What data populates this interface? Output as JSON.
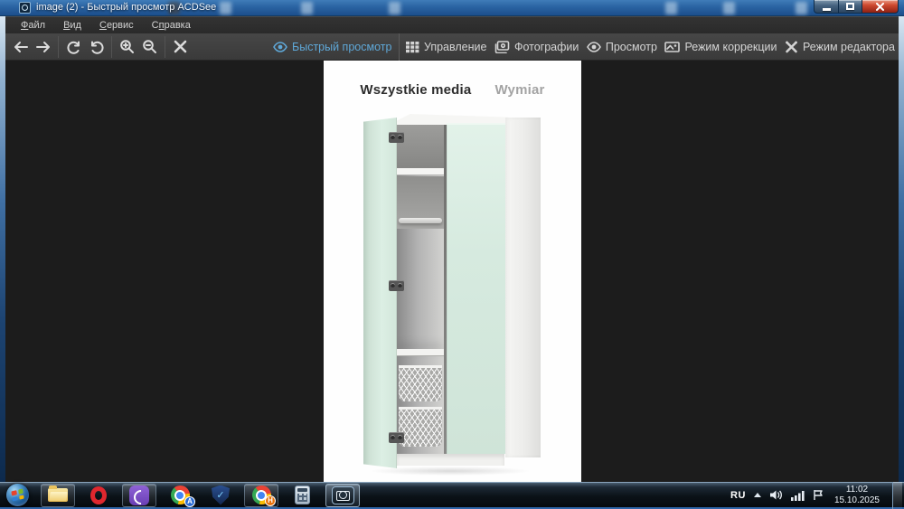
{
  "window": {
    "title": "image (2) - Быстрый просмотр ACDSee"
  },
  "menu": {
    "items": [
      {
        "pre": "",
        "hot": "Ф",
        "post": "айл"
      },
      {
        "pre": "",
        "hot": "В",
        "post": "ид"
      },
      {
        "pre": "",
        "hot": "С",
        "post": "ервис"
      },
      {
        "pre": "С",
        "hot": "п",
        "post": "равка"
      }
    ]
  },
  "toolbar": {
    "buttons": [
      "back",
      "forward",
      "rotate-left",
      "rotate-right",
      "zoom-in",
      "zoom-out",
      "close-image"
    ]
  },
  "modes": {
    "tabs": [
      {
        "label": "Быстрый просмотр",
        "icon": "quick-view-eye-icon",
        "active": true
      },
      {
        "label": "Управление",
        "icon": "manage-grid-icon",
        "active": false
      },
      {
        "label": "Фотографии",
        "icon": "photos-icon",
        "active": false
      },
      {
        "label": "Просмотр",
        "icon": "view-eye-icon",
        "active": false
      },
      {
        "label": "Режим коррекции",
        "icon": "develop-mode-icon",
        "active": false
      },
      {
        "label": "Режим редактора",
        "icon": "edit-mode-icon",
        "active": false
      }
    ]
  },
  "viewer": {
    "tab_all_media": "Wszystkie media",
    "tab_dimension": "Wymiar",
    "image_subject": "tall white wardrobe with pale mint doors, open door revealing shelf, clothes rail and two wire baskets"
  },
  "taskbar": {
    "apps": [
      {
        "name": "windows-explorer",
        "running": true
      },
      {
        "name": "opera-browser",
        "running": false
      },
      {
        "name": "viber",
        "running": true
      },
      {
        "name": "browser-a",
        "running": false
      },
      {
        "name": "antivirus-shield",
        "running": false
      },
      {
        "name": "browser-h",
        "running": true
      },
      {
        "name": "calculator",
        "running": false
      },
      {
        "name": "acdsee-viewer",
        "running": true,
        "active": true
      }
    ],
    "badges": {
      "browser_a": "A",
      "browser_h": "H"
    },
    "tray": {
      "language": "RU",
      "time": "11:02",
      "date": "15.10.2025"
    }
  },
  "colors": {
    "titlebar_blue": "#2a66a8",
    "active_tab_text": "#5fa8d8",
    "content_background": "#1c1c1c",
    "mint_door": "#d6e8dd",
    "taskbar_dark": "#0b1218"
  }
}
